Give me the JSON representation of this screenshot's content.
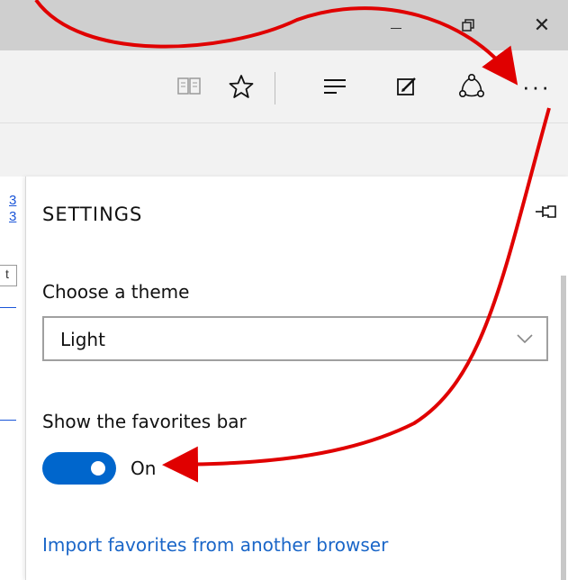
{
  "window": {
    "minimize_icon": "minimize-icon",
    "restore_glyph": "🗗",
    "close_glyph": "✕"
  },
  "toolbar": {
    "icons": [
      "reading-view-icon",
      "favorites-star-icon",
      "hub-icon",
      "web-note-icon",
      "share-icon",
      "more-actions-icon"
    ],
    "more_label": "···"
  },
  "settings": {
    "title": "SETTINGS",
    "theme_label": "Choose a theme",
    "theme_value": "Light",
    "favorites_bar_label": "Show the favorites bar",
    "favorites_bar_state": "On",
    "favorites_bar_enabled": true,
    "import_link": "Import favorites from another browser"
  },
  "page_fragment": {
    "line1": "3",
    "line2": "3",
    "box_char": "t"
  },
  "colors": {
    "accent": "#0066cc",
    "link": "#1a66c8",
    "annotation_arrow": "#e00000",
    "titlebar": "#cfcfcf",
    "toolbar": "#f2f2f2"
  }
}
